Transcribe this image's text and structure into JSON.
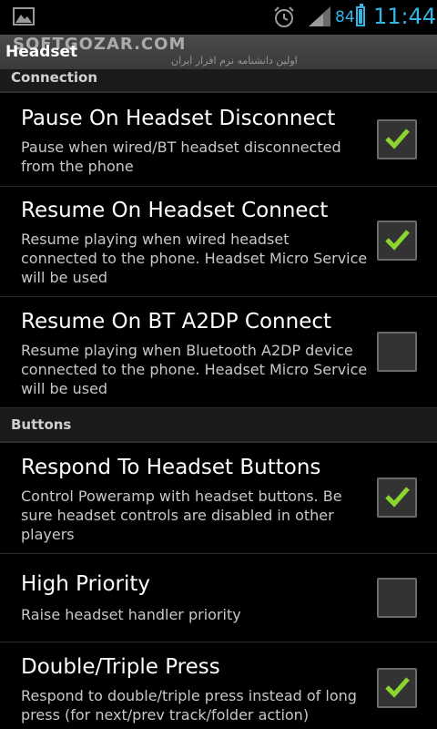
{
  "status_bar": {
    "battery_level": "84",
    "time": "11:44",
    "accent_color": "#33b5e5",
    "icons": [
      "gallery-icon",
      "alarm-icon",
      "signal-icon",
      "battery-icon"
    ]
  },
  "header": {
    "title": "Headset",
    "watermark": "SOFTGOZAR.COM",
    "watermark_sub": "اولین دانشنامه نرم افزار ایران"
  },
  "sections": [
    {
      "label": "Connection"
    },
    {
      "label": "Buttons"
    }
  ],
  "prefs": [
    {
      "title": "Pause On Headset Disconnect",
      "summary": "Pause when wired/BT headset disconnected from the phone",
      "checked": true
    },
    {
      "title": "Resume On Headset Connect",
      "summary": "Resume playing when wired headset connected to the phone. Headset Micro Service will be used",
      "checked": true
    },
    {
      "title": "Resume On BT A2DP Connect",
      "summary": "Resume playing when Bluetooth A2DP device connected to the phone. Headset Micro Service will be used",
      "checked": false
    },
    {
      "title": "Respond To Headset Buttons",
      "summary": "Control Poweramp with headset buttons. Be sure headset controls are disabled in other players",
      "checked": true
    },
    {
      "title": "High Priority",
      "summary": "Raise headset handler priority",
      "checked": false
    },
    {
      "title": "Double/Triple Press",
      "summary": "Respond to double/triple press instead of long press (for next/prev track/folder action)",
      "checked": true
    }
  ],
  "colors": {
    "check": "#8bd52f"
  }
}
